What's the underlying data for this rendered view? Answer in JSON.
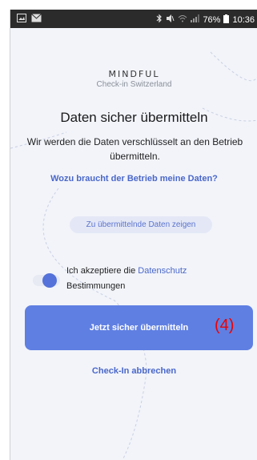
{
  "status_bar": {
    "left_icons": [
      "image-icon",
      "mail-icon"
    ],
    "right_icons": [
      "bluetooth-icon",
      "mute-icon",
      "wifi-icon",
      "signal-icon",
      "battery-icon"
    ],
    "battery": "76%",
    "time": "10:36"
  },
  "brand": {
    "logo": "MINDFUL",
    "subtitle": "Check-in Switzerland"
  },
  "main": {
    "title": "Daten sicher übermitteln",
    "description": "Wir werden die Daten verschlüsselt an den Betrieb übermitteln.",
    "why_link": "Wozu braucht der Betrieb meine Daten?",
    "show_data_button": "Zu übermittelnde Daten zeigen",
    "consent_prefix": "Ich akzeptiere die",
    "consent_link": "Datenschutz",
    "consent_suffix": "Bestimmungen",
    "consent_toggle_on": true,
    "submit_button": "Jetzt sicher übermitteln",
    "step_annotation": "(4)",
    "cancel_link": "Check-In abbrechen"
  },
  "colors": {
    "accent": "#5f7fe2",
    "link": "#4a67c9",
    "background": "#f2f4fa",
    "annotation": "#e00000"
  }
}
